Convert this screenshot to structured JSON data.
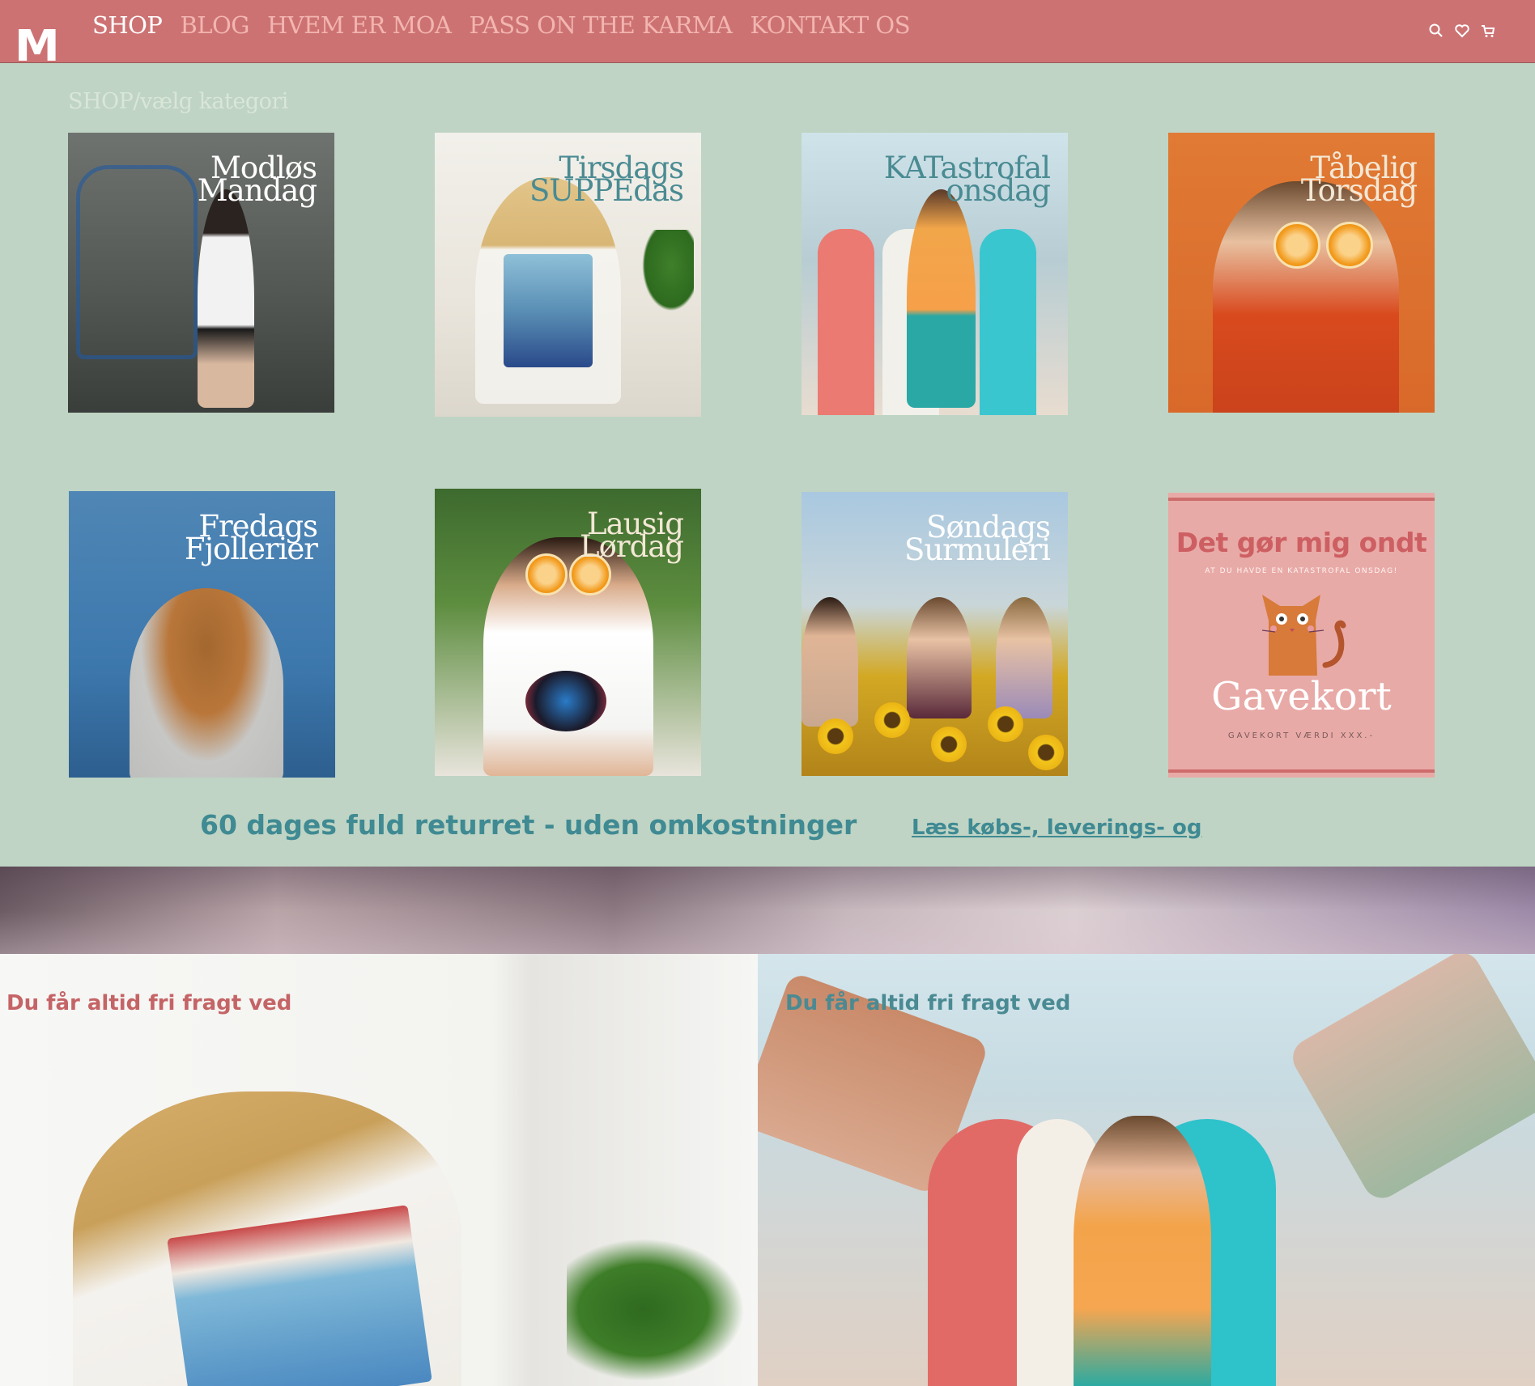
{
  "nav": {
    "logo": "M",
    "items": [
      {
        "label": "SHOP",
        "active": true
      },
      {
        "label": "BLOG",
        "active": false
      },
      {
        "label": "HVEM ER MOA",
        "active": false
      },
      {
        "label": "PASS ON THE KARMA",
        "active": false
      },
      {
        "label": "KONTAKT OS",
        "active": false
      }
    ],
    "icons": [
      "search-icon",
      "heart-icon",
      "cart-icon"
    ]
  },
  "breadcrumb": "SHOP/vælg kategori",
  "categories": [
    {
      "line1": "Modløs",
      "line2": "Mandag"
    },
    {
      "line1": "Tirsdags",
      "line2": "SUPPEdas"
    },
    {
      "line1": "KATastrofal",
      "line2": "onsdag"
    },
    {
      "line1": "Tåbelig",
      "line2": "Torsdag"
    },
    {
      "line1": "Fredags",
      "line2": "Fjollerier"
    },
    {
      "line1": "Lausig",
      "line2": "Lørdag"
    },
    {
      "line1": "Søndags",
      "line2": "Surmuleri"
    }
  ],
  "giftcard": {
    "headline": "Det gør  mig ondt",
    "subline": "AT DU HAVDE EN KATASTROFAL ONSDAG!",
    "title": "Gavekort",
    "value": "GAVEKORT VÆRDI XXX.-"
  },
  "info": {
    "returns": "60 dages fuld returret - uden omkostninger",
    "terms_link": "Læs købs-, leverings- og"
  },
  "promos": {
    "left_text": "Du får altid fri fragt ved",
    "right_text": "Du får altid fri fragt ved"
  },
  "colors": {
    "nav_bg": "#cd7273",
    "page_bg": "#bfd4c4",
    "accent_teal": "#3f8a93",
    "accent_pink": "#c56466"
  }
}
